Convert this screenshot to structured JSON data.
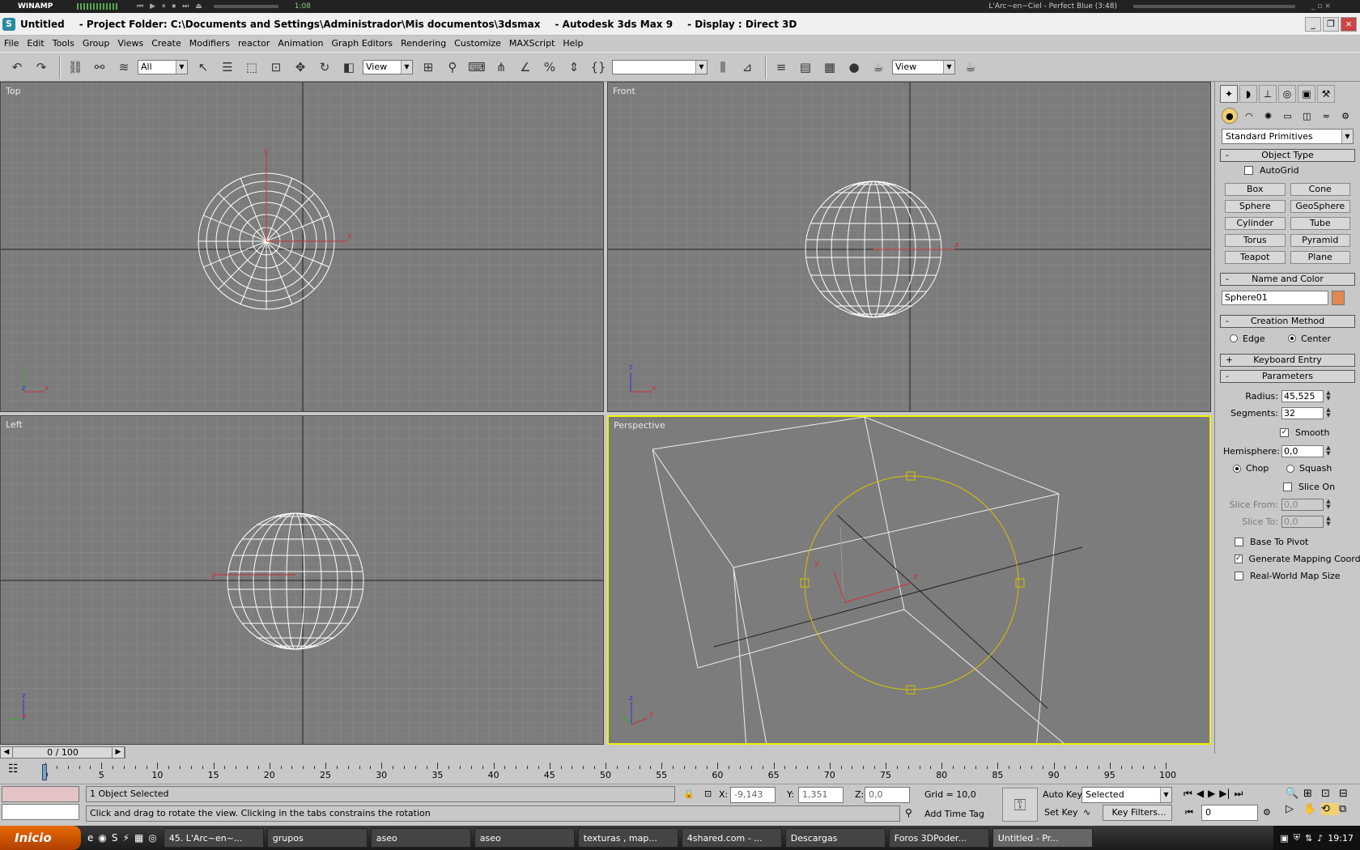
{
  "winamp": {
    "title": "WINAMP",
    "time": "1:08",
    "song": "L'Arc~en~Ciel - Perfect Blue (3:48)"
  },
  "window": {
    "title": "Untitled",
    "project": "- Project Folder: C:\\Documents and Settings\\Administrador\\Mis documentos\\3dsmax",
    "app": "- Autodesk 3ds Max 9",
    "display": "- Display : Direct 3D"
  },
  "menu": [
    "File",
    "Edit",
    "Tools",
    "Group",
    "Views",
    "Create",
    "Modifiers",
    "reactor",
    "Animation",
    "Graph Editors",
    "Rendering",
    "Customize",
    "MAXScript",
    "Help"
  ],
  "toolbar": {
    "selection_filter": "All",
    "ref_coord": "View",
    "named_sel": "",
    "render_view": "View"
  },
  "viewports": {
    "top": "Top",
    "front": "Front",
    "left": "Left",
    "perspective": "Perspective"
  },
  "command_panel": {
    "category": "Standard Primitives",
    "object_type": {
      "title": "Object Type",
      "autogrid": "AutoGrid",
      "buttons": [
        "Box",
        "Cone",
        "Sphere",
        "GeoSphere",
        "Cylinder",
        "Tube",
        "Torus",
        "Pyramid",
        "Teapot",
        "Plane"
      ]
    },
    "name_color": {
      "title": "Name and Color",
      "name": "Sphere01",
      "color": "#e08a50"
    },
    "creation": {
      "title": "Creation Method",
      "edge": "Edge",
      "center": "Center"
    },
    "keyboard": {
      "title": "Keyboard Entry"
    },
    "params": {
      "title": "Parameters",
      "radius_label": "Radius:",
      "radius": "45,525",
      "segments_label": "Segments:",
      "segments": "32",
      "smooth": "Smooth",
      "hemisphere_label": "Hemisphere:",
      "hemisphere": "0,0",
      "chop": "Chop",
      "squash": "Squash",
      "slice_on": "Slice On",
      "slice_from_label": "Slice From:",
      "slice_from": "0,0",
      "slice_to_label": "Slice To:",
      "slice_to": "0,0",
      "base_pivot": "Base To Pivot",
      "gen_mapping": "Generate Mapping Coords.",
      "real_world": "Real-World Map Size"
    }
  },
  "time": {
    "slider": "0 / 100",
    "ticks": [
      "0",
      "5",
      "10",
      "15",
      "20",
      "25",
      "30",
      "35",
      "40",
      "45",
      "50",
      "55",
      "60",
      "65",
      "70",
      "75",
      "80",
      "85",
      "90",
      "95",
      "100"
    ]
  },
  "status": {
    "selected": "1 Object Selected",
    "prompt": "Click and drag to rotate the view.  Clicking in the tabs constrains the rotation",
    "x_label": "X:",
    "x": "-9,143",
    "y_label": "Y:",
    "y": "1,351",
    "z_label": "Z:",
    "z": "0,0",
    "grid": "Grid = 10,0",
    "add_time_tag": "Add Time Tag",
    "auto_key": "Auto Key",
    "set_key": "Set Key",
    "key_mode": "Selected",
    "key_filters": "Key Filters...",
    "frame": "0"
  },
  "taskbar": {
    "start": "Inicio",
    "tasks": [
      "45. L'Arc~en~...",
      "grupos",
      "aseo",
      "aseo",
      "texturas , map...",
      "4shared.com - ...",
      "Descargas",
      "Foros 3DPoder...",
      "Untitled     - Pr..."
    ],
    "clock": "19:17"
  }
}
